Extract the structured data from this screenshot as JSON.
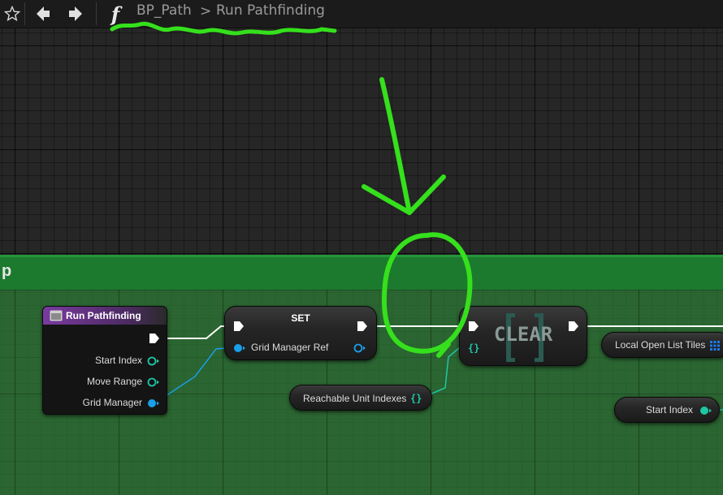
{
  "toolbar": {
    "function_symbol": "f",
    "breadcrumb": [
      "BP_Path",
      "Run Pathfinding"
    ],
    "breadcrumb_separator": ">"
  },
  "comment_box": {
    "title": "p",
    "color": "#2e8c3a"
  },
  "nodes": {
    "entry": {
      "title": "Run Pathfinding",
      "pins": [
        "Start Index",
        "Move Range",
        "Grid Manager"
      ],
      "header_color": "#6b2f8c"
    },
    "set": {
      "title": "SET",
      "input_pin": "Grid Manager Ref"
    },
    "clear": {
      "title": "CLEAR"
    },
    "reachable": {
      "label": "Reachable Unit Indexes"
    },
    "local_open": {
      "label": "Local Open List Tiles"
    },
    "start_index": {
      "label": "Start Index"
    }
  },
  "colors": {
    "integer_pin": "#1fc7a4",
    "object_pin": "#1a9ee8",
    "set_pin": "#1fc7a4",
    "exec_pin": "#ffffff",
    "annotation": "#35e01c"
  },
  "icons": {
    "star": "star-icon",
    "back": "back-arrow-icon",
    "forward": "forward-arrow-icon",
    "function": "function-icon",
    "array": "array-grid-icon"
  }
}
